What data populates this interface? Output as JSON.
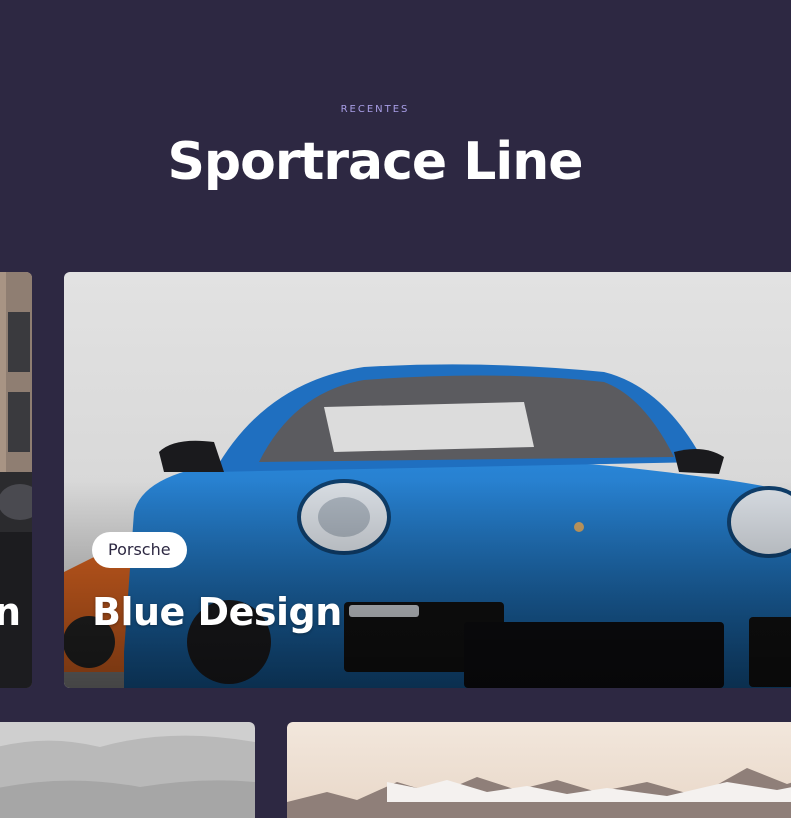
{
  "section": {
    "eyebrow": "RECENTES",
    "title": "Sportrace Line"
  },
  "cards": {
    "left_partial": {
      "title_fragment": "n"
    },
    "main": {
      "tag": "Porsche",
      "title": "Blue Design"
    }
  },
  "colors": {
    "background": "#2d2842",
    "eyebrow": "#a89ee6",
    "car_blue": "#1f6fc0"
  }
}
